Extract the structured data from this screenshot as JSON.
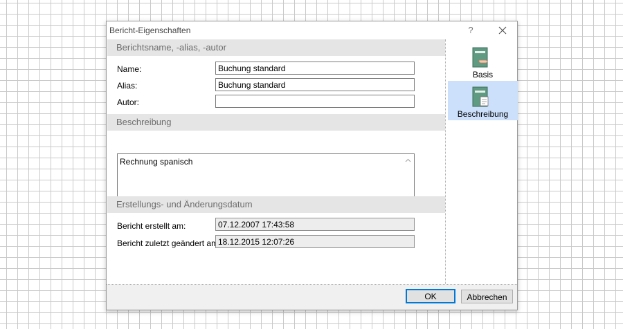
{
  "window": {
    "title": "Bericht-Eigenschaften",
    "help": "?"
  },
  "sections": {
    "name": {
      "header": "Berichtsname, -alias, -autor",
      "fields": {
        "name": {
          "label": "Name:",
          "value": "Buchung standard"
        },
        "alias": {
          "label": "Alias:",
          "value": "Buchung standard"
        },
        "author": {
          "label": "Autor:",
          "value": ""
        }
      }
    },
    "description": {
      "header": "Beschreibung",
      "text": "Rechnung spanisch"
    },
    "dates": {
      "header": "Erstellungs- und Änderungsdatum",
      "created": {
        "label": "Bericht erstellt am:",
        "value": "07.12.2007 17:43:58"
      },
      "modified": {
        "label": "Bericht zuletzt geändert am:",
        "value": "18.12.2015 12:07:26"
      }
    }
  },
  "sidebar": {
    "items": [
      {
        "label": "Basis",
        "icon": "book-hand-icon",
        "selected": false
      },
      {
        "label": "Beschreibung",
        "icon": "book-document-icon",
        "selected": true
      }
    ]
  },
  "footer": {
    "ok_label": "OK",
    "cancel_label": "Abbrechen"
  },
  "colors": {
    "selection": "#cce0fb",
    "section_header_bg": "#e5e5e5",
    "default_button_border": "#0078d7",
    "icon_green": "#5f9a82"
  }
}
